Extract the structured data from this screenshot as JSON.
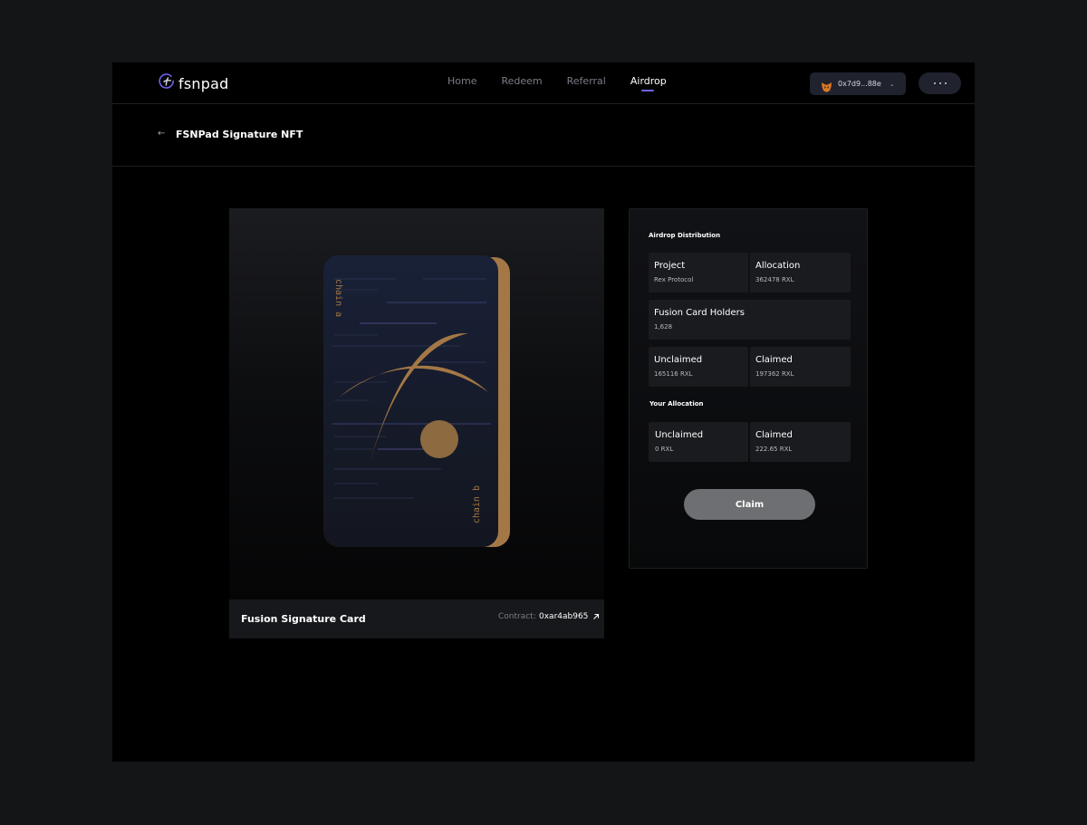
{
  "brand": {
    "name": "fsnpad",
    "logo_icon": "fsnpad-logo-icon"
  },
  "nav": {
    "items": [
      {
        "label": "Home",
        "active": false
      },
      {
        "label": "Redeem",
        "active": false
      },
      {
        "label": "Referral",
        "active": false
      },
      {
        "label": "Airdrop",
        "active": true
      }
    ]
  },
  "wallet": {
    "address": "0x7d9...88e",
    "icon": "metamask-fox-icon"
  },
  "subheader": {
    "back_icon": "arrow-left-icon",
    "title": "FSNPad Signature NFT"
  },
  "nft": {
    "card_text_top": "chain a",
    "card_text_bottom": "chain b",
    "name": "Fusion Signature Card",
    "contract_label": "Contract:",
    "contract_value": "0xar4ab965"
  },
  "airdrop": {
    "distribution_title": "Airdrop Distribution",
    "project_label": "Project",
    "project_value": "Rex Protocol",
    "allocation_label": "Allocation",
    "allocation_value": "362478 RXL",
    "holders_label": "Fusion Card Holders",
    "holders_value": "1,628",
    "unclaimed_label": "Unclaimed",
    "unclaimed_value": "165116 RXL",
    "claimed_label": "Claimed",
    "claimed_value": "197362 RXL",
    "your_title": "Your Allocation",
    "your_unclaimed_label": "Unclaimed",
    "your_unclaimed_value": "0 RXL",
    "your_claimed_label": "Claimed",
    "your_claimed_value": "222.65 RXL",
    "claim_button": "Claim"
  },
  "colors": {
    "accent": "#6d63f0",
    "gold": "#a47846",
    "card_bg": "#151a2a",
    "claim_button": "#6e6f72"
  }
}
